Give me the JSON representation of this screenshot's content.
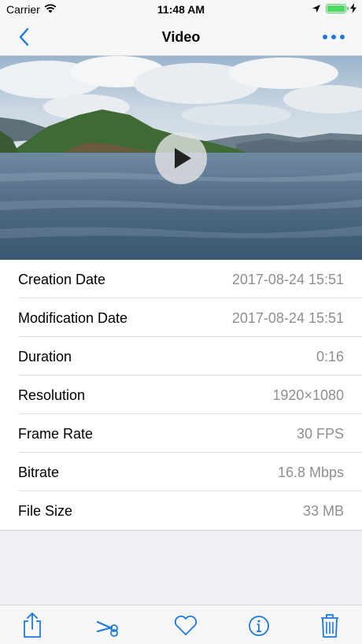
{
  "status": {
    "carrier": "Carrier",
    "time": "11:48 AM"
  },
  "nav": {
    "title": "Video",
    "back_icon": "chevron-left-icon",
    "more_icon": "ellipsis-icon"
  },
  "video": {
    "thumbnail": "lake-with-hill-and-clouds",
    "play_icon": "play-icon"
  },
  "details": [
    {
      "label": "Creation Date",
      "value": "2017-08-24  15:51"
    },
    {
      "label": "Modification Date",
      "value": "2017-08-24  15:51"
    },
    {
      "label": "Duration",
      "value": "0:16"
    },
    {
      "label": "Resolution",
      "value": "1920×1080"
    },
    {
      "label": "Frame Rate",
      "value": "30 FPS"
    },
    {
      "label": "Bitrate",
      "value": "16.8 Mbps"
    },
    {
      "label": "File Size",
      "value": "33 MB"
    }
  ],
  "toolbar": {
    "icons": [
      "share-icon",
      "scissors-icon",
      "heart-icon",
      "info-icon",
      "trash-icon"
    ]
  },
  "colors": {
    "accent": "#1a7ae0",
    "secondary_text": "#8e8e93",
    "background": "#efeff4",
    "battery": "#4cd964"
  }
}
